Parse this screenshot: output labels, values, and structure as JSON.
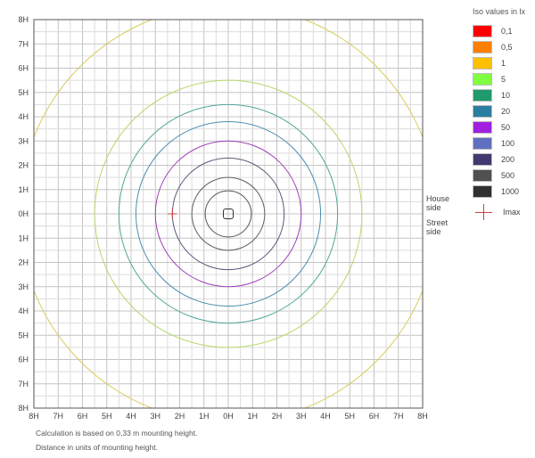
{
  "chart_data": {
    "type": "isolux",
    "axis_ticks_x": [
      "8H",
      "7H",
      "6H",
      "5H",
      "4H",
      "3H",
      "2H",
      "1H",
      "0H",
      "1H",
      "2H",
      "3H",
      "4H",
      "5H",
      "6H",
      "7H",
      "8H"
    ],
    "axis_ticks_y": [
      "8H",
      "7H",
      "6H",
      "5H",
      "4H",
      "3H",
      "2H",
      "1H",
      "0H",
      "1H",
      "2H",
      "3H",
      "4H",
      "5H",
      "6H",
      "7H",
      "8H"
    ],
    "xlim": [
      -8,
      8
    ],
    "ylim": [
      -8,
      8
    ],
    "grid": true,
    "legend_title": "Iso values in lx",
    "legend_placement": "right",
    "levels": [
      {
        "label": "0,1",
        "value": 0.1,
        "color": "#ff0000"
      },
      {
        "label": "0,5",
        "value": 0.5,
        "color": "#ff8000"
      },
      {
        "label": "1",
        "value": 1,
        "color": "#ffc000"
      },
      {
        "label": "5",
        "value": 5,
        "color": "#80ff40"
      },
      {
        "label": "10",
        "value": 10,
        "color": "#1f9a6a"
      },
      {
        "label": "20",
        "value": 20,
        "color": "#2a7fa0"
      },
      {
        "label": "50",
        "value": 50,
        "color": "#a020e0"
      },
      {
        "label": "100",
        "value": 100,
        "color": "#6070c0"
      },
      {
        "label": "200",
        "value": 200,
        "color": "#403a70"
      },
      {
        "label": "500",
        "value": 500,
        "color": "#505050"
      },
      {
        "label": "1000",
        "value": 1000,
        "color": "#303030"
      }
    ],
    "isolines": [
      {
        "level": "1",
        "radius": 8.6,
        "color": "#d8cc5a"
      },
      {
        "level": "5",
        "radius": 5.5,
        "color": "#b6d86a"
      },
      {
        "level": "10",
        "radius": 4.5,
        "color": "#52a69a"
      },
      {
        "level": "20",
        "radius": 3.8,
        "color": "#4a8eb0"
      },
      {
        "level": "50",
        "radius": 3.0,
        "color": "#a040b8"
      },
      {
        "level": "100",
        "radius": 2.3,
        "color": "#5a5a7a"
      },
      {
        "level": "200",
        "radius": 1.5,
        "color": "#606060"
      },
      {
        "level": "500",
        "radius": 0.95,
        "color": "#555555"
      },
      {
        "level": "1000",
        "radius": 0.15,
        "color": "#333333"
      }
    ],
    "imax": {
      "label": "Imax",
      "x": -2.3,
      "y": 0
    }
  },
  "side_labels": {
    "house": [
      "House",
      "side"
    ],
    "street": [
      "Street",
      "side"
    ]
  },
  "footnotes": [
    "Calculation is based on 0,33 m mounting height.",
    "Distance in units of mounting height."
  ]
}
